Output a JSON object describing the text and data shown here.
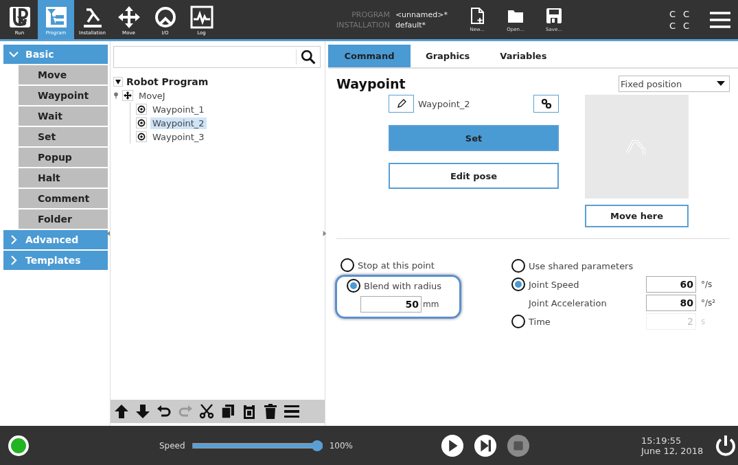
{
  "nav": [
    {
      "kind": "run",
      "label": "Run",
      "selected": false
    },
    {
      "kind": "program",
      "label": "Program",
      "selected": true
    },
    {
      "kind": "installation",
      "label": "Installation",
      "selected": false
    },
    {
      "kind": "move",
      "label": "Move",
      "selected": false
    },
    {
      "kind": "io",
      "label": "I/O",
      "selected": false
    },
    {
      "kind": "log",
      "label": "Log",
      "selected": false
    }
  ],
  "program_info": {
    "program_label": "PROGRAM",
    "program": "<unnamed>*",
    "installation_label": "INSTALLATION",
    "installation": "default*"
  },
  "file_buttons": [
    {
      "kind": "new",
      "label": "New..."
    },
    {
      "kind": "open",
      "label": "Open..."
    },
    {
      "kind": "save",
      "label": "Save..."
    }
  ],
  "status_letters": [
    "C",
    "C",
    "C",
    "C"
  ],
  "sidebar": [
    {
      "label": "Basic",
      "expanded": true,
      "items": [
        "Move",
        "Waypoint",
        "Wait",
        "Set",
        "Popup",
        "Halt",
        "Comment",
        "Folder"
      ]
    },
    {
      "label": "Advanced",
      "expanded": false
    },
    {
      "label": "Templates",
      "expanded": false
    }
  ],
  "tree": {
    "label": "Robot Program",
    "expanded": true,
    "children": [
      {
        "label": "MoveJ",
        "children": [
          {
            "label": "Waypoint_1",
            "selected": false
          },
          {
            "label": "Waypoint_2",
            "selected": true
          },
          {
            "label": "Waypoint_3",
            "selected": false
          }
        ]
      }
    ]
  },
  "toolbar": [
    {
      "kind": "up",
      "disabled": false
    },
    {
      "kind": "down",
      "disabled": false
    },
    {
      "kind": "undo",
      "disabled": false
    },
    {
      "kind": "redo",
      "disabled": true
    },
    {
      "kind": "cut",
      "disabled": false
    },
    {
      "kind": "copy",
      "disabled": false
    },
    {
      "kind": "paste",
      "disabled": false
    },
    {
      "kind": "delete",
      "disabled": false
    },
    {
      "kind": "suppress",
      "disabled": false
    }
  ],
  "tabs": [
    {
      "label": "Command",
      "selected": true
    },
    {
      "label": "Graphics",
      "selected": false
    },
    {
      "label": "Variables",
      "selected": false
    }
  ],
  "panel": {
    "title": "Waypoint",
    "position_type": "Fixed position",
    "name": "Waypoint_2",
    "set_button": "Set",
    "edit_button": "Edit pose",
    "move_button": "Move here"
  },
  "blend": {
    "options": [
      {
        "label": "Stop at this point",
        "selected": false
      },
      {
        "label": "Blend with radius",
        "selected": true
      }
    ],
    "radius": "50",
    "unit": "mm"
  },
  "motion": [
    {
      "kind": "radio",
      "label": "Use shared parameters",
      "selected": false
    },
    {
      "kind": "radio",
      "label": "Joint Speed",
      "selected": true,
      "value": "60",
      "unit": "°/s",
      "disabled": false
    },
    {
      "kind": "label",
      "label": "Joint Acceleration",
      "value": "80",
      "unit": "°/s²",
      "disabled": false
    },
    {
      "kind": "radio",
      "label": "Time",
      "selected": false,
      "value": "2",
      "unit": "s",
      "disabled": true
    }
  ],
  "footer": {
    "status_light": {
      "color": "#22b422"
    },
    "speed_label": "Speed",
    "speed": {
      "level": 1.0,
      "reading": "100%"
    },
    "controls": [
      {
        "kind": "play",
        "disabled": false
      },
      {
        "kind": "step",
        "disabled": false
      },
      {
        "kind": "stop",
        "disabled": true
      }
    ],
    "time": "15:19:55",
    "date": "June 12, 2018"
  }
}
